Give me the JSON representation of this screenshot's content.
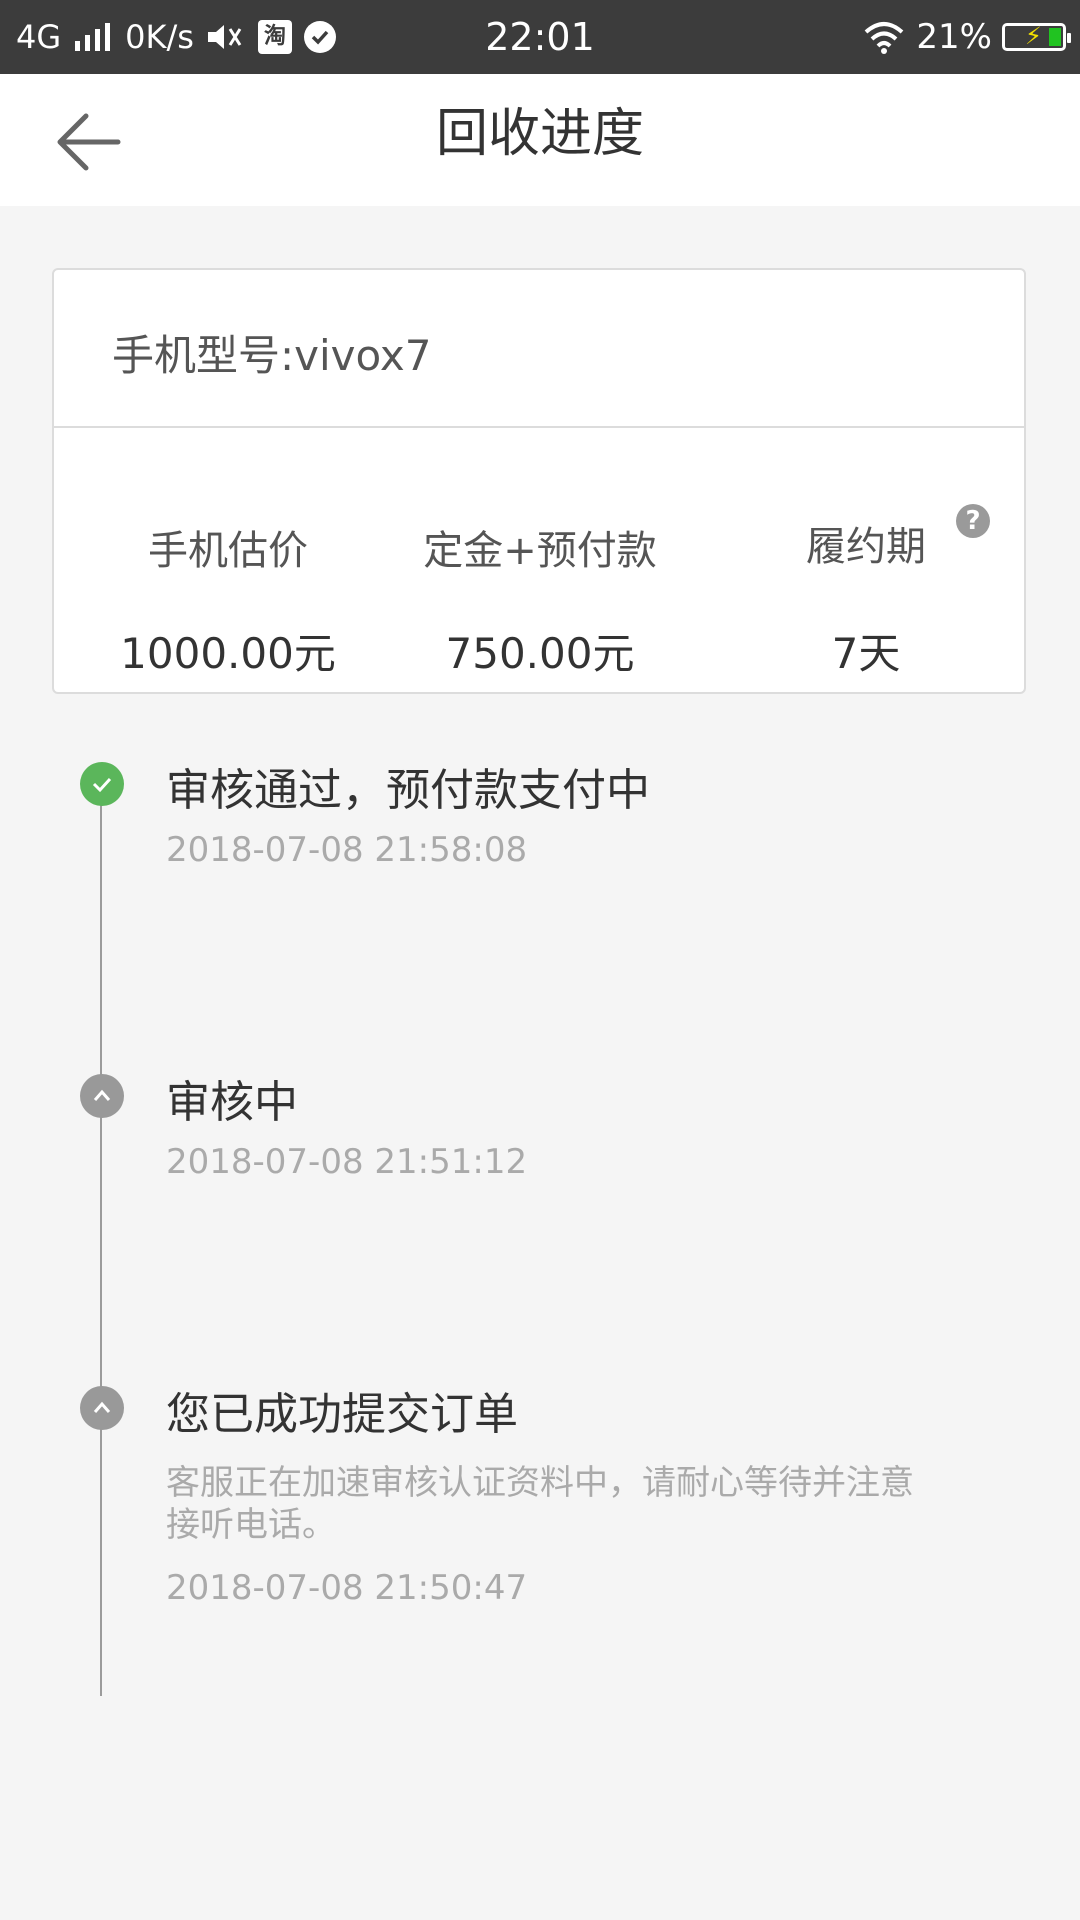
{
  "status_bar": {
    "network": "4G",
    "speed": "0K/s",
    "taobao_badge": "淘",
    "time": "22:01",
    "battery": "21%",
    "icons": [
      "signal-icon",
      "volume-icon",
      "taobao-icon",
      "check-icon",
      "wifi-icon",
      "battery-icon"
    ]
  },
  "header": {
    "title": "回收进度",
    "back_icon": "arrow-left-icon"
  },
  "card": {
    "model": "手机型号:vivox7",
    "stats": [
      {
        "label": "手机估价",
        "value": "1000.00元"
      },
      {
        "label": "定金+预付款",
        "value": "750.00元"
      },
      {
        "label": "履约期",
        "value": "7天"
      }
    ],
    "help": "?"
  },
  "timeline": [
    {
      "title": "审核通过，预付款支付中",
      "time": "2018-07-08 21:58:08",
      "status": "done"
    },
    {
      "title": "审核中",
      "time": "2018-07-08 21:51:12",
      "status": "pending"
    },
    {
      "title": "您已成功提交订单",
      "desc": "客服正在加速审核认证资料中，请耐心等待并注意接听电话。",
      "time": "2018-07-08 21:50:47",
      "status": "pending"
    }
  ],
  "colors": {
    "done": "#5bb65b",
    "pending": "#999999",
    "background": "#f5f5f5",
    "status_bar": "#3c3c3c"
  }
}
